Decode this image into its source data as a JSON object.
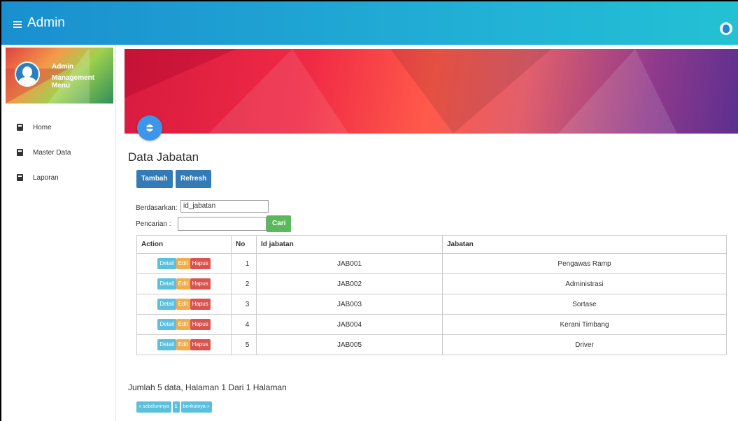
{
  "app": {
    "title": "Admin"
  },
  "profile": {
    "name": "Admin",
    "role": "Management Menu"
  },
  "sidebar": {
    "items": [
      {
        "label": "Home"
      },
      {
        "label": "Master Data"
      },
      {
        "label": "Laporan"
      }
    ]
  },
  "page": {
    "title": "Data Jabatan"
  },
  "toolbar": {
    "add_label": "Tambah",
    "refresh_label": "Refresh"
  },
  "search": {
    "by_label": "Berdasarkan:",
    "by_value": "id_jabatan",
    "query_label": "Pencarian :",
    "query_value": "",
    "button_label": "Cari"
  },
  "table": {
    "headers": [
      "Action",
      "No",
      "Id jabatan",
      "Jabatan"
    ],
    "action_labels": {
      "detail": "Detail",
      "edit": "Edit",
      "delete": "Hapus"
    },
    "rows": [
      {
        "no": "1",
        "id": "JAB001",
        "jabatan": "Pengawas Ramp"
      },
      {
        "no": "2",
        "id": "JAB002",
        "jabatan": "Administrasi"
      },
      {
        "no": "3",
        "id": "JAB003",
        "jabatan": "Sortase"
      },
      {
        "no": "4",
        "id": "JAB004",
        "jabatan": "Kerani Timbang"
      },
      {
        "no": "5",
        "id": "JAB005",
        "jabatan": "Driver"
      }
    ]
  },
  "summary": "Jumlah 5 data, Halaman 1 Dari 1 Halaman",
  "pagination": {
    "prev": "« sebelumnya",
    "current": "1",
    "next": "berikutnya »"
  },
  "colors": {
    "topbar": "#1a8fcf",
    "primary": "#337ab7",
    "success": "#5cb85c",
    "info": "#5bc0de",
    "warning": "#f0ad4e",
    "danger": "#d9534f"
  }
}
